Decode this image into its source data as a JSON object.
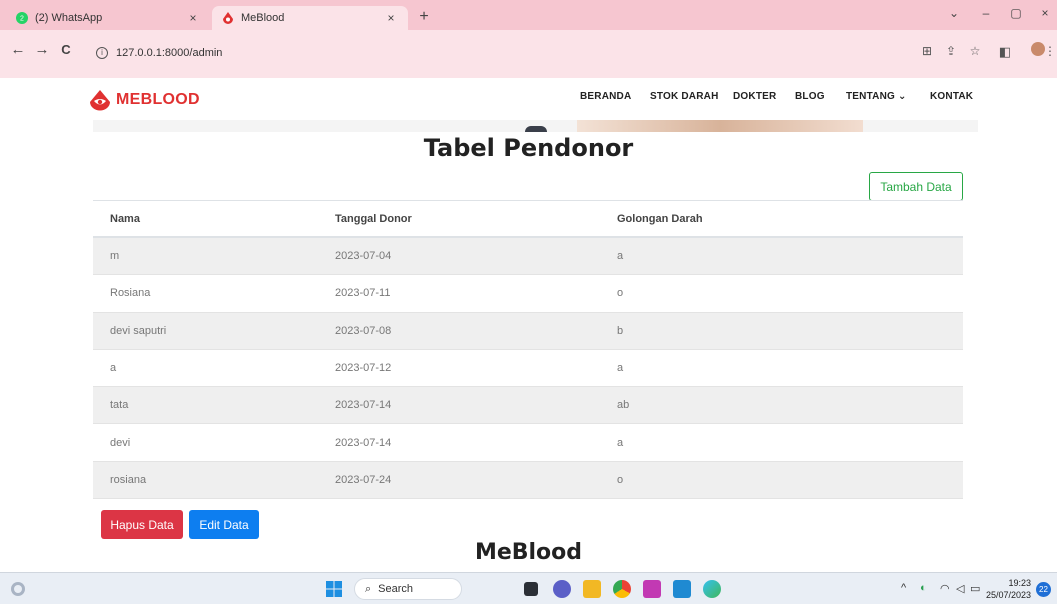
{
  "browser": {
    "tabs": [
      {
        "title": "(2) WhatsApp",
        "close": "×"
      },
      {
        "title": "MeBlood",
        "close": "×"
      }
    ],
    "new_tab": "+",
    "window_controls": [
      "⌄",
      "–",
      "▢",
      "×"
    ],
    "nav": {
      "back": "←",
      "forward": "→",
      "reload": "C"
    },
    "address": "127.0.0.1:8000/admin"
  },
  "site": {
    "logo_text": "MEBLOOD",
    "brand_color": "#e03131",
    "menu": [
      "BERANDA",
      "STOK DARAH",
      "DOKTER",
      "BLOG",
      "TENTANG ⌄",
      "KONTAK"
    ]
  },
  "main": {
    "title": "Tabel Pendonor",
    "add_button": "Tambah Data",
    "table": {
      "headers": [
        "Nama",
        "Tanggal Donor",
        "Golongan Darah"
      ],
      "rows": [
        [
          "m",
          "2023-07-04",
          "a"
        ],
        [
          "Rosiana",
          "2023-07-11",
          "o"
        ],
        [
          "devi saputri",
          "2023-07-08",
          "b"
        ],
        [
          "a",
          "2023-07-12",
          "a"
        ],
        [
          "tata",
          "2023-07-14",
          "ab"
        ],
        [
          "devi",
          "2023-07-14",
          "a"
        ],
        [
          "rosiana",
          "2023-07-24",
          "o"
        ]
      ]
    },
    "delete_button": "Hapus Data",
    "edit_button": "Edit Data",
    "footer_title": "MeBlood"
  },
  "taskbar": {
    "search_placeholder": "Search",
    "time": "19:23",
    "date": "25/07/2023",
    "notifications": "22"
  }
}
